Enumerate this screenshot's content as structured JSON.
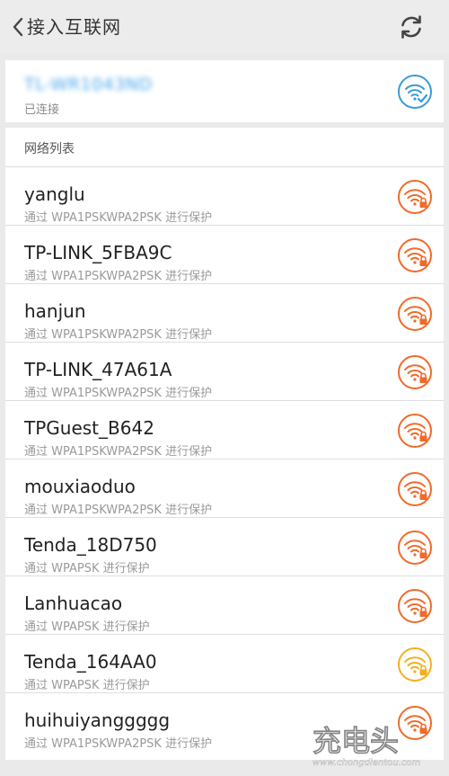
{
  "header": {
    "title": "接入互联网"
  },
  "connected": {
    "name": "TL-WR1043ND",
    "status": "已连接",
    "color": "#3a9ad9"
  },
  "list": {
    "heading": "网络列表",
    "items": [
      {
        "ssid": "yanglu",
        "security": "通过 WPA1PSKWPA2PSK 进行保护",
        "color": "#f06a2a"
      },
      {
        "ssid": "TP-LINK_5FBA9C",
        "security": "通过 WPA1PSKWPA2PSK 进行保护",
        "color": "#f06a2a"
      },
      {
        "ssid": "hanjun",
        "security": "通过 WPA1PSKWPA2PSK 进行保护",
        "color": "#f06a2a"
      },
      {
        "ssid": "TP-LINK_47A61A",
        "security": "通过 WPA1PSKWPA2PSK 进行保护",
        "color": "#f06a2a"
      },
      {
        "ssid": "TPGuest_B642",
        "security": "通过 WPA1PSKWPA2PSK 进行保护",
        "color": "#f06a2a"
      },
      {
        "ssid": "mouxiaoduo",
        "security": "通过 WPA1PSKWPA2PSK 进行保护",
        "color": "#f06a2a"
      },
      {
        "ssid": "Tenda_18D750",
        "security": "通过 WPAPSK 进行保护",
        "color": "#f06a2a"
      },
      {
        "ssid": "Lanhuacao",
        "security": "通过 WPAPSK 进行保护",
        "color": "#f06a2a"
      },
      {
        "ssid": "Tenda_164AA0",
        "security": "通过 WPAPSK 进行保护",
        "color": "#f2b01e"
      },
      {
        "ssid": "huihuiyanggggg",
        "security": "通过 WPA1PSKWPA2PSK 进行保护",
        "color": "#f06a2a"
      }
    ]
  },
  "watermark": {
    "text": "充电头",
    "subtext": "www.chongdiantou.com"
  },
  "icons": {
    "back": "chevron-left-icon",
    "refresh": "refresh-icon",
    "connected": "wifi-connected-icon",
    "secured": "wifi-lock-icon"
  }
}
